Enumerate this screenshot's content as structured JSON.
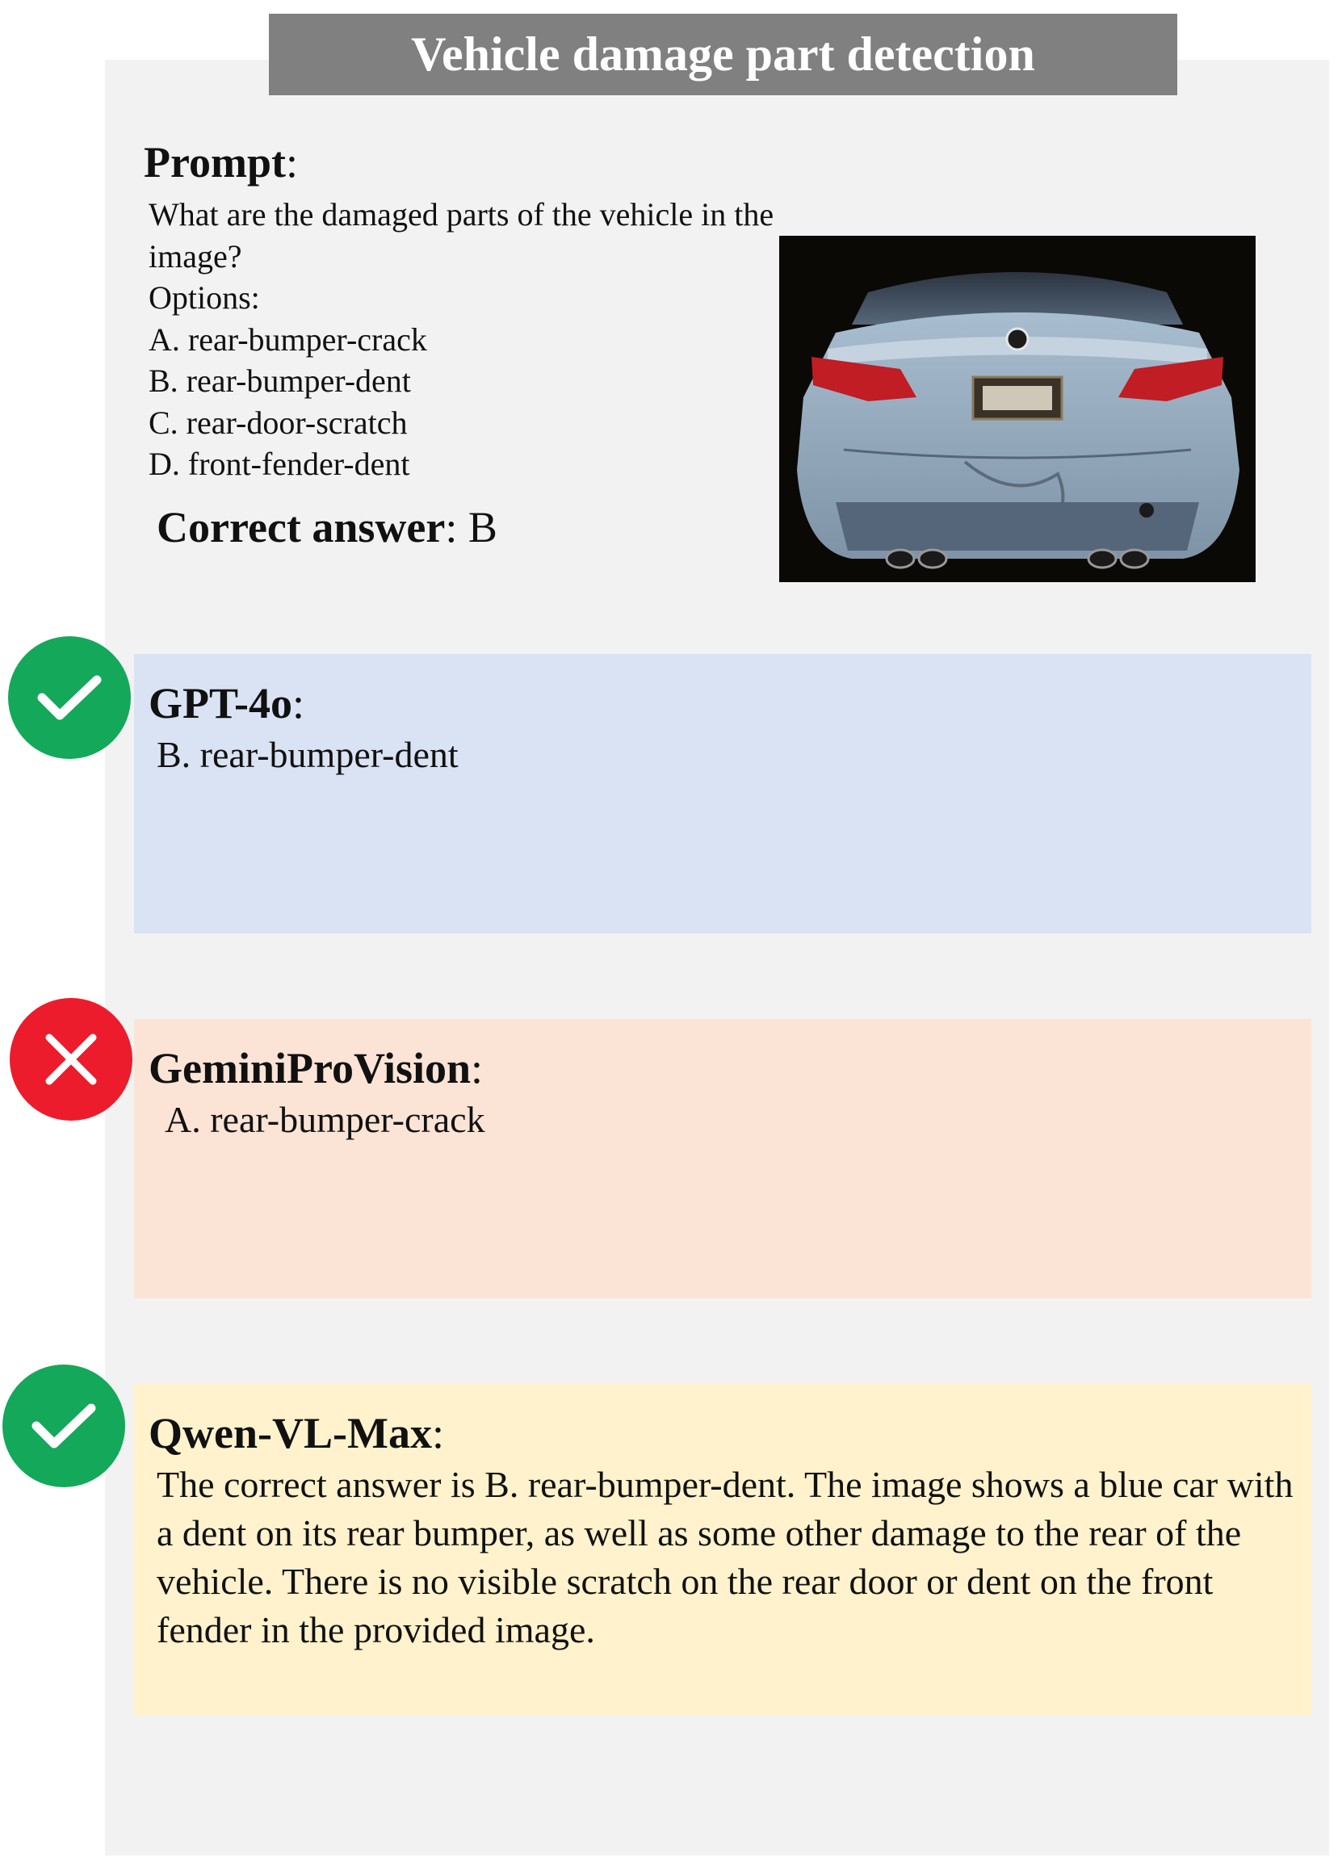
{
  "title": "Vehicle damage part detection",
  "prompt": {
    "heading": "Prompt",
    "question_line1": "What are the damaged parts of the vehicle in the",
    "question_line2": "image?",
    "options_label": "Options:",
    "options": [
      "A. rear-bumper-crack",
      "B. rear-bumper-dent",
      "C. rear-door-scratch",
      "D. front-fender-dent"
    ],
    "correct_label": "Correct answer",
    "correct_value": "B"
  },
  "responses": [
    {
      "model": "GPT-4o",
      "verdict": "correct",
      "icon": "check-icon",
      "answer": "B. rear-bumper-dent",
      "color": "#dae3f3"
    },
    {
      "model": "GeminiProVision",
      "verdict": "incorrect",
      "icon": "cross-icon",
      "answer": "A. rear-bumper-crack",
      "color": "#fbe4d6"
    },
    {
      "model": "Qwen-VL-Max",
      "verdict": "correct",
      "icon": "check-icon",
      "answer": "The correct answer is B. rear-bumper-dent. The image shows a blue car with a dent on its rear bumper, as well as some other damage to the rear of the vehicle. There is no visible scratch on the rear door or dent on the front fender in the provided image.",
      "color": "#fff2cc"
    }
  ],
  "colors": {
    "correct": "#14a85a",
    "incorrect": "#ec1c2c",
    "title_bar": "#808080",
    "panel": "#f2f2f2"
  }
}
